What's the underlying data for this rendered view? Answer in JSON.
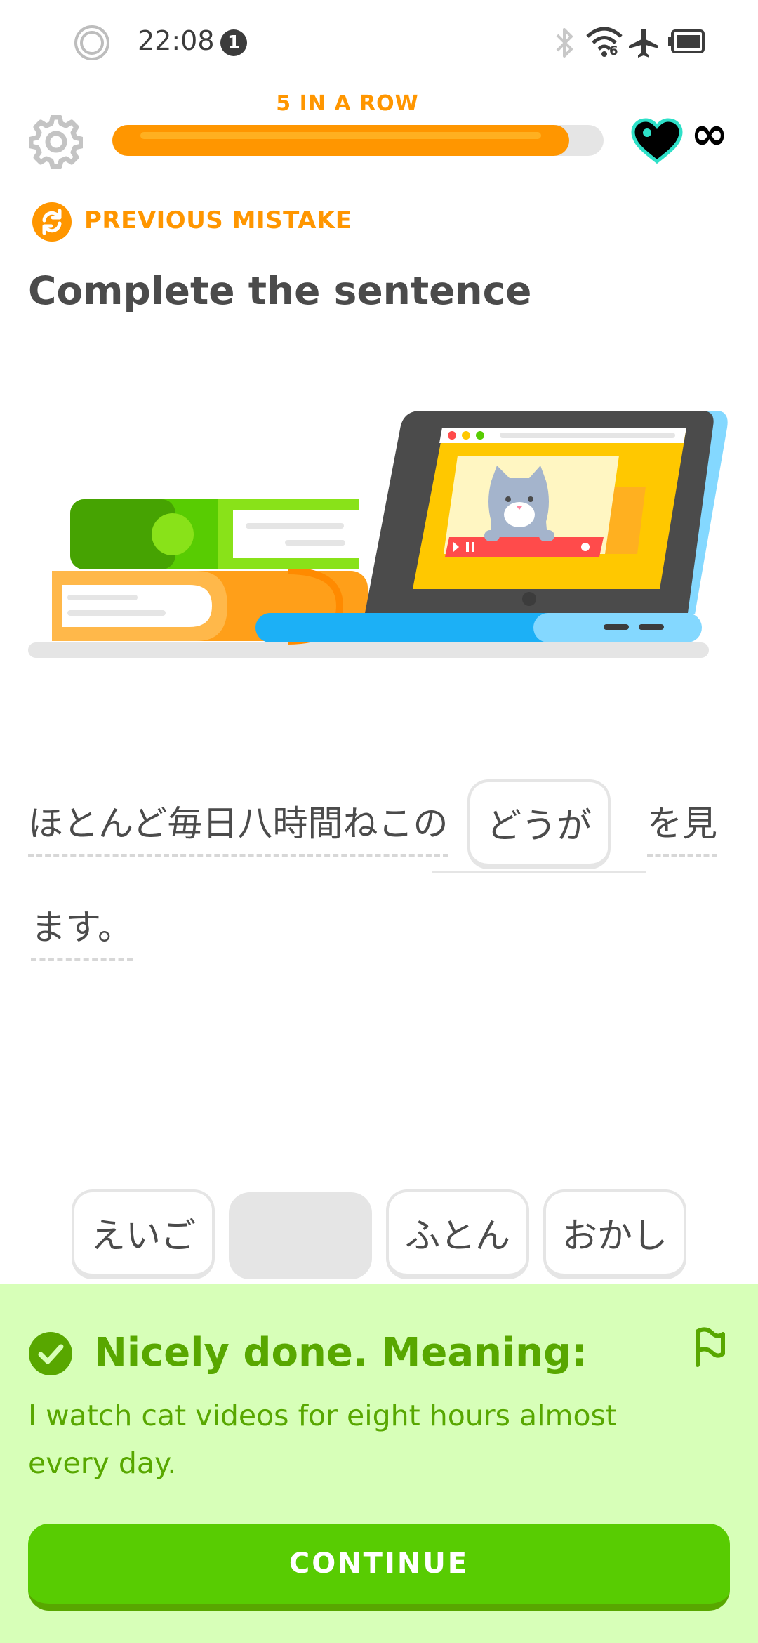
{
  "status_bar": {
    "time": "22:08",
    "notification_count": "1",
    "wifi_badge": "6",
    "icons": [
      "record-icon",
      "bluetooth-icon",
      "wifi-icon",
      "airplane-icon",
      "battery-icon"
    ]
  },
  "header": {
    "streak_label": "5 IN A ROW",
    "progress_fraction": 0.93,
    "hearts_value": "∞"
  },
  "lesson": {
    "badge_label": "PREVIOUS MISTAKE",
    "title": "Complete the sentence",
    "sentence_part1": "ほとんど毎日八時間ねこの",
    "answer": "どうが",
    "sentence_part2": "を見",
    "sentence_part3": "ます。"
  },
  "word_bank": [
    {
      "label": "えいご",
      "used": false
    },
    {
      "label": "",
      "used": true
    },
    {
      "label": "ふとん",
      "used": false
    },
    {
      "label": "おかし",
      "used": false
    }
  ],
  "feedback": {
    "heading": "Nicely done. Meaning:",
    "meaning": "I watch cat videos for eight hours almost every day.",
    "continue_label": "CONTINUE"
  },
  "colors": {
    "accent_orange": "#ff9600",
    "success_green": "#58cc02",
    "success_dark": "#58a700",
    "feedback_bg": "#d7ffb8"
  }
}
